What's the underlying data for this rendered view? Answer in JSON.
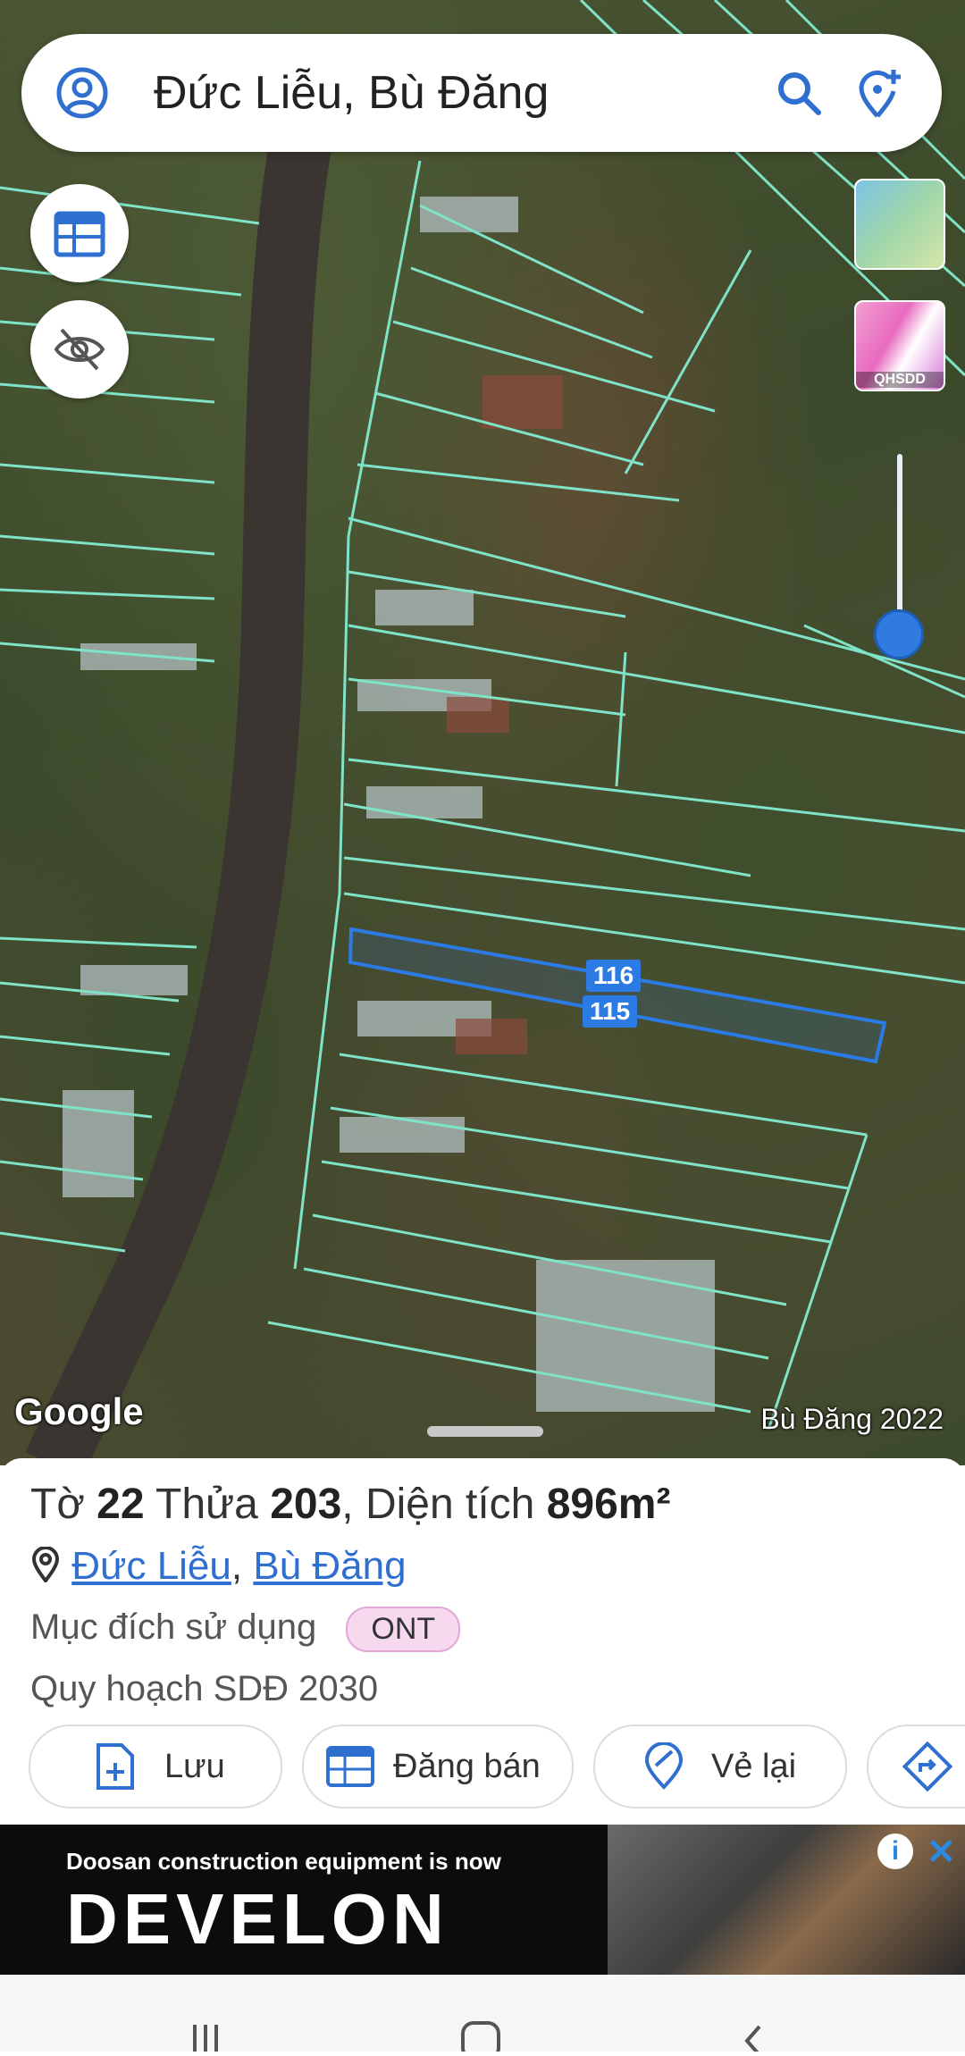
{
  "search": {
    "title": "Đức Liễu, Bù Đăng"
  },
  "map": {
    "layers": {
      "qh_label": "QHSDD"
    },
    "parcels": {
      "top": "116",
      "bottom": "115"
    },
    "logo": "Google",
    "attribution": "Bù Đăng 2022"
  },
  "sheet": {
    "title_prefix": "Tờ",
    "sheet_no": "22",
    "plot_word": "Thửa",
    "plot_no": "203",
    "area_prefix": ", Diện tích",
    "area_value": "896m²",
    "commune": "Đức Liễu",
    "separator": ",",
    "district": "Bù Đăng",
    "purpose_label": "Mục đích sử dụng",
    "purpose_badge": "ONT",
    "plan_label": "Quy hoạch SDĐ 2030",
    "actions": {
      "save": "Lưu",
      "sell": "Đăng bán",
      "redraw": "Vẻ lại"
    }
  },
  "ad": {
    "line1": "Doosan construction equipment is now",
    "brand": "DEVELON",
    "info": "i",
    "close": "✕"
  },
  "colors": {
    "parcel_line": "#7fe3c8",
    "highlight": "#2c7be5",
    "accent": "#2f6fd0"
  }
}
